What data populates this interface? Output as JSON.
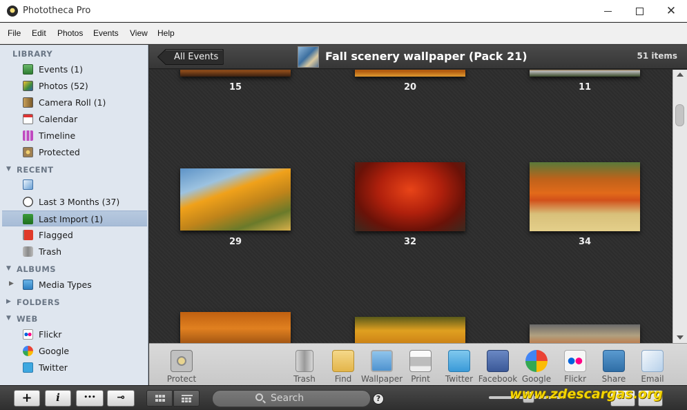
{
  "window": {
    "title": "Phototheca Pro"
  },
  "menu": [
    "File",
    "Edit",
    "Photos",
    "Events",
    "View",
    "Help"
  ],
  "sidebar": {
    "sections": {
      "library": "LIBRARY",
      "recent": "RECENT",
      "albums": "ALBUMS",
      "folders": "FOLDERS",
      "web": "WEB"
    },
    "library_items": [
      "Events (1)",
      "Photos (52)",
      "Camera Roll (1)",
      "Calendar",
      "Timeline",
      "Protected"
    ],
    "recent_items": [
      "",
      "Last 3 Months (37)",
      "Last Import (1)",
      "Flagged",
      "Trash"
    ],
    "album_items": [
      "Media Types"
    ],
    "web_items": [
      "Flickr",
      "Google",
      "Twitter"
    ],
    "selected": "Last Import (1)"
  },
  "header": {
    "back_label": "All Events",
    "event_title": "Fall scenery wallpaper (Pack 21)",
    "item_count": "51 items"
  },
  "grid": {
    "row1": [
      "15",
      "20",
      "11"
    ],
    "row2": [
      "29",
      "32",
      "34"
    ]
  },
  "toolbar": {
    "protect": "Protect",
    "trash": "Trash",
    "find": "Find",
    "wallpaper": "Wallpaper",
    "print": "Print",
    "twitter": "Twitter",
    "facebook": "Facebook",
    "google": "Google",
    "flickr": "Flickr",
    "share": "Share",
    "email": "Email"
  },
  "bottom": {
    "add_symbol": "+",
    "info_symbol": "i",
    "more_symbol": "•••",
    "key_symbol": "⊸",
    "search_placeholder": "Search",
    "help_symbol": "?",
    "watermark": "www.zdescargas.org"
  },
  "colors": {
    "sidebar_bg": "#dfe6ef",
    "selection": "#aec2db",
    "header_bg": "#3e3e3e",
    "grid_bg": "#2d2d2d",
    "watermark": "#f3d400"
  }
}
